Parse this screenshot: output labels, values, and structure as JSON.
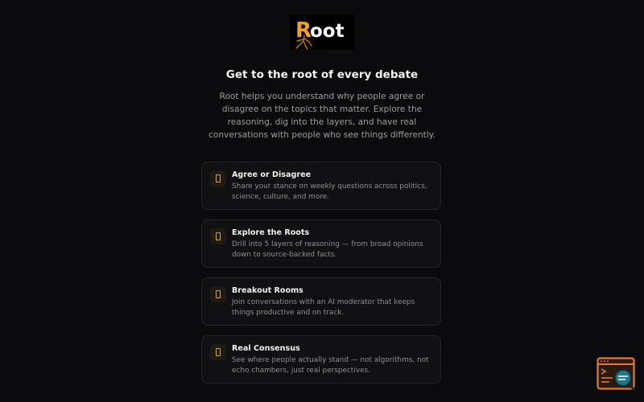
{
  "brand": {
    "logo_text": "Root",
    "accent_color": "#f0a02a"
  },
  "hero": {
    "headline": "Get to the root of every debate",
    "intro": "Root helps you understand why people agree or disagree on the topics that matter. Explore the reasoning, dig into the layers, and have real conversations with people who see things differently."
  },
  "features": [
    {
      "icon": "card-icon",
      "title": "Agree or Disagree",
      "description": "Share your stance on weekly questions across politics, science, culture, and more."
    },
    {
      "icon": "card-icon",
      "title": "Explore the Roots",
      "description": "Drill into 5 layers of reasoning — from broad opinions down to source-backed facts."
    },
    {
      "icon": "card-icon",
      "title": "Breakout Rooms",
      "description": "Join conversations with an AI moderator that keeps things productive and on track."
    },
    {
      "icon": "card-icon",
      "title": "Real Consensus",
      "description": "See where people actually stand — not algorithms, not echo chambers, just real perspectives."
    }
  ],
  "widget": {
    "icon": "code-search-icon",
    "frame_color": "#e07a3c",
    "lens_color": "#1d7a86"
  }
}
